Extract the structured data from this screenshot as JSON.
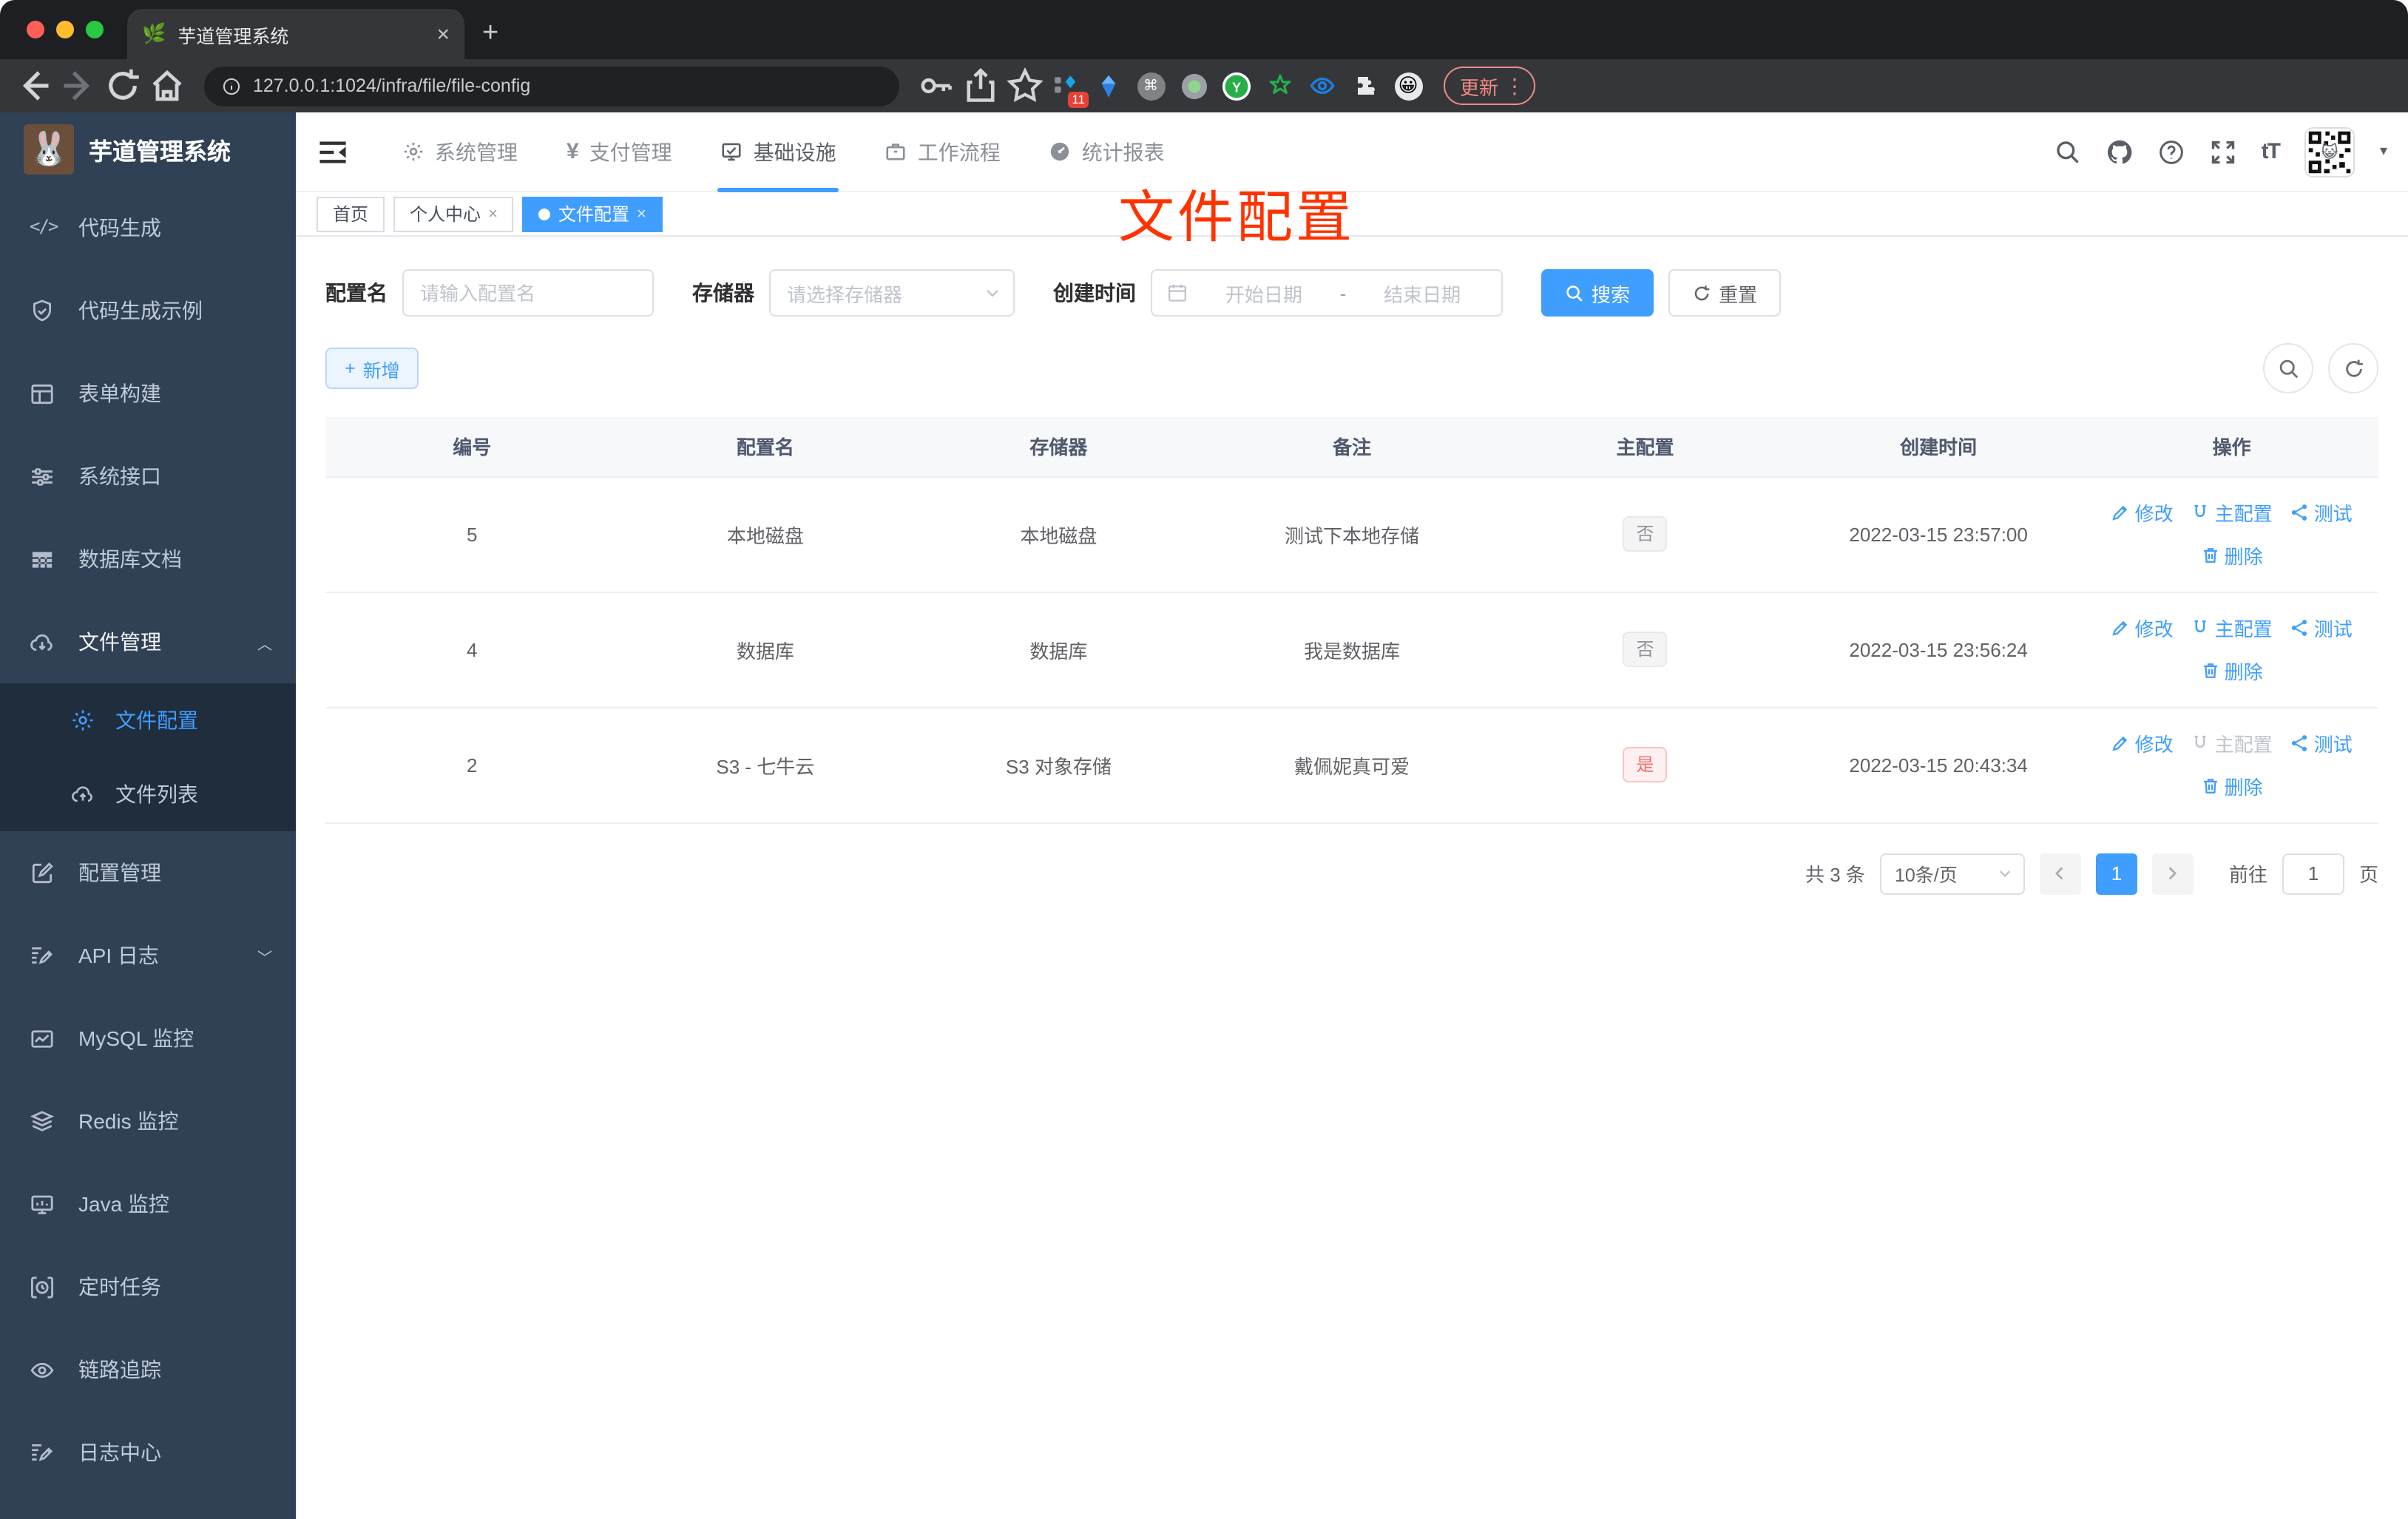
{
  "browser": {
    "tab_title": "芋道管理系统",
    "url": "127.0.0.1:1024/infra/file/file-config",
    "update_label": "更新",
    "extension_badge": "11"
  },
  "icons": {
    "favicon": "🌿",
    "logo": "🐰",
    "yen": "¥",
    "cmd": "⌘",
    "ext_y": "Y",
    "emoji": "😀",
    "qr_emoji": "😺",
    "close": "×",
    "plus": "+",
    "caret": "▾",
    "ellipsis": "⋮",
    "font_size": "tT",
    "arrow_up": "︿",
    "arrow_down": "﹀"
  },
  "sidebar": {
    "title": "芋道管理系统",
    "items": [
      {
        "label": "代码生成"
      },
      {
        "label": "代码生成示例"
      },
      {
        "label": "表单构建"
      },
      {
        "label": "系统接口"
      },
      {
        "label": "数据库文档"
      },
      {
        "label": "文件管理",
        "children": [
          {
            "label": "文件配置"
          },
          {
            "label": "文件列表"
          }
        ]
      },
      {
        "label": "配置管理"
      },
      {
        "label": "API 日志"
      },
      {
        "label": "MySQL 监控"
      },
      {
        "label": "Redis 监控"
      },
      {
        "label": "Java 监控"
      },
      {
        "label": "定时任务"
      },
      {
        "label": "链路追踪"
      },
      {
        "label": "日志中心"
      }
    ]
  },
  "topnav": {
    "items": [
      {
        "label": "系统管理"
      },
      {
        "label": "支付管理"
      },
      {
        "label": "基础设施"
      },
      {
        "label": "工作流程"
      },
      {
        "label": "统计报表"
      }
    ]
  },
  "tags": {
    "items": [
      {
        "label": "首页"
      },
      {
        "label": "个人中心"
      },
      {
        "label": "文件配置"
      }
    ]
  },
  "overlay": {
    "label": "文件配置",
    "color": "#ff3300"
  },
  "filters": {
    "name_label": "配置名",
    "name_placeholder": "请输入配置名",
    "storage_label": "存储器",
    "storage_placeholder": "请选择存储器",
    "date_label": "创建时间",
    "date_start_placeholder": "开始日期",
    "date_separator": "-",
    "date_end_placeholder": "结束日期",
    "search_label": "搜索",
    "reset_label": "重置"
  },
  "toolbar": {
    "add_label": "新增"
  },
  "table": {
    "headers": [
      "编号",
      "配置名",
      "存储器",
      "备注",
      "主配置",
      "创建时间",
      "操作"
    ],
    "action_labels": {
      "edit": "修改",
      "master": "主配置",
      "test": "测试",
      "delete": "删除"
    },
    "rows": [
      {
        "no": "5",
        "name": "本地磁盘",
        "storage": "本地磁盘",
        "remark": "测试下本地存储",
        "master": "否",
        "created": "2022-03-15 23:57:00"
      },
      {
        "no": "4",
        "name": "数据库",
        "storage": "数据库",
        "remark": "我是数据库",
        "master": "否",
        "created": "2022-03-15 23:56:24"
      },
      {
        "no": "2",
        "name": "S3 - 七牛云",
        "storage": "S3 对象存储",
        "remark": "戴佩妮真可爱",
        "master": "是",
        "created": "2022-03-15 20:43:34"
      }
    ]
  },
  "pagination": {
    "total": "共 3 条",
    "page_size": "10条/页",
    "page": "1",
    "goto_label": "前往",
    "goto_value": "1",
    "goto_suffix": "页"
  },
  "colors": {
    "accent": "#409eff",
    "sidebar_bg": "#304156",
    "submenu_bg": "#1f2d3d",
    "danger": "#f56c6c",
    "annotation": "#ff3300"
  }
}
